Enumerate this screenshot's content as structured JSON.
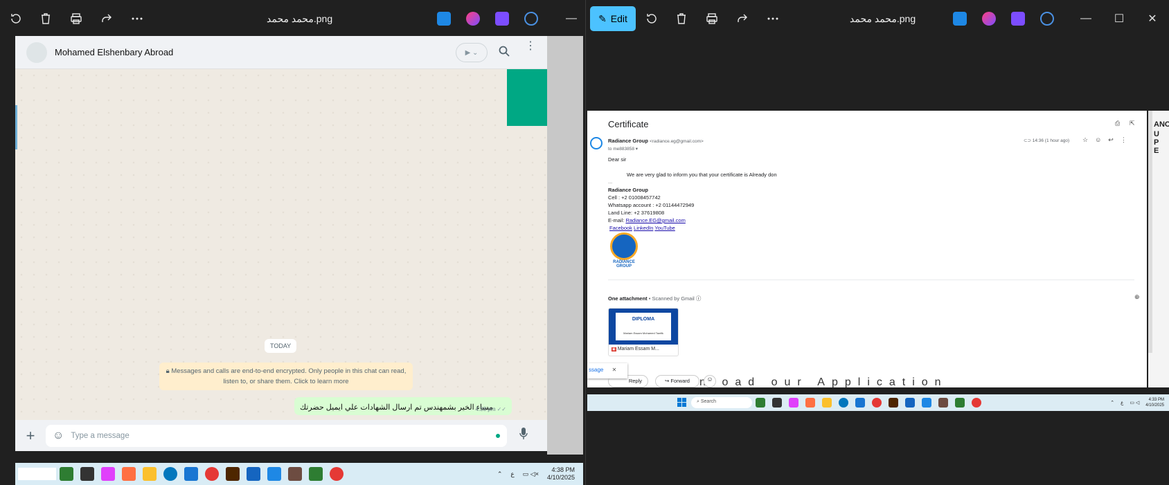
{
  "left_window": {
    "title": "محمد محمد.png",
    "whatsapp": {
      "contact_name": "Mohamed Elshenbary Abroad",
      "date_chip": "TODAY",
      "encryption_notice_line1": "Messages and calls are end-to-end encrypted. Only people in this chat can read,",
      "encryption_notice_line2": "listen to, or share them. Click to learn more",
      "message_text": "مساء الخير بشمهندس تم ارسال الشهادات علي ايميل حضرتك",
      "message_time": "4:38 pm",
      "input_placeholder": "Type a message"
    },
    "taskbar": {
      "time": "4:38 PM",
      "date": "4/10/2025",
      "lang": "ع"
    }
  },
  "right_window": {
    "title": "محمد محمد.png",
    "edit_label": "Edit",
    "gmail": {
      "subject": "Certificate",
      "sender_name": "Radiance Group",
      "sender_email": "<radiance.eg@gmail.com>",
      "recipient": "to me883858",
      "timestamp": "14:36 (1 hour ago)",
      "greeting": "Dear sir",
      "body": "We are very glad to inform you that your certificate is Already don",
      "ellipsis": "...",
      "sig_name": "Radiance Group",
      "sig_cell": "Cell : +2 01008457742",
      "sig_whatsapp": "Whatsapp account : +2 01144472949",
      "sig_landline": "Land Line: +2 37619808",
      "sig_email_label": "E-mail:",
      "sig_email_link": "Radiance.EG@gmail.com",
      "link_facebook": "Facebook",
      "link_linkedin": "LinkedIn",
      "link_youtube": "YouTube",
      "logo_text1": "RADIANCE",
      "logo_text2": "GROUP",
      "attachment_heading": "One attachment",
      "attachment_scan": "• Scanned by Gmail",
      "attachment_title": "DIPLOMA",
      "attachment_name": "Mariam Essam M...",
      "attachment_line": "Mariam Essam Mohamed Tawfik",
      "reply_label": "Reply",
      "forward_label": "Forward",
      "snackbar_text": "ssage",
      "bg_text": "Download our Application",
      "edge_text": "ANCE",
      "edge_text2": "U P E"
    },
    "taskbar": {
      "search": "Search",
      "time": "4:33 PM",
      "date": "4/10/2025",
      "lang": "ع"
    }
  },
  "colors": {
    "whatsapp_green": "#00a884",
    "bubble_out": "#d9fdd3",
    "notice": "#ffeecd",
    "edit_blue": "#4cc2ff"
  }
}
